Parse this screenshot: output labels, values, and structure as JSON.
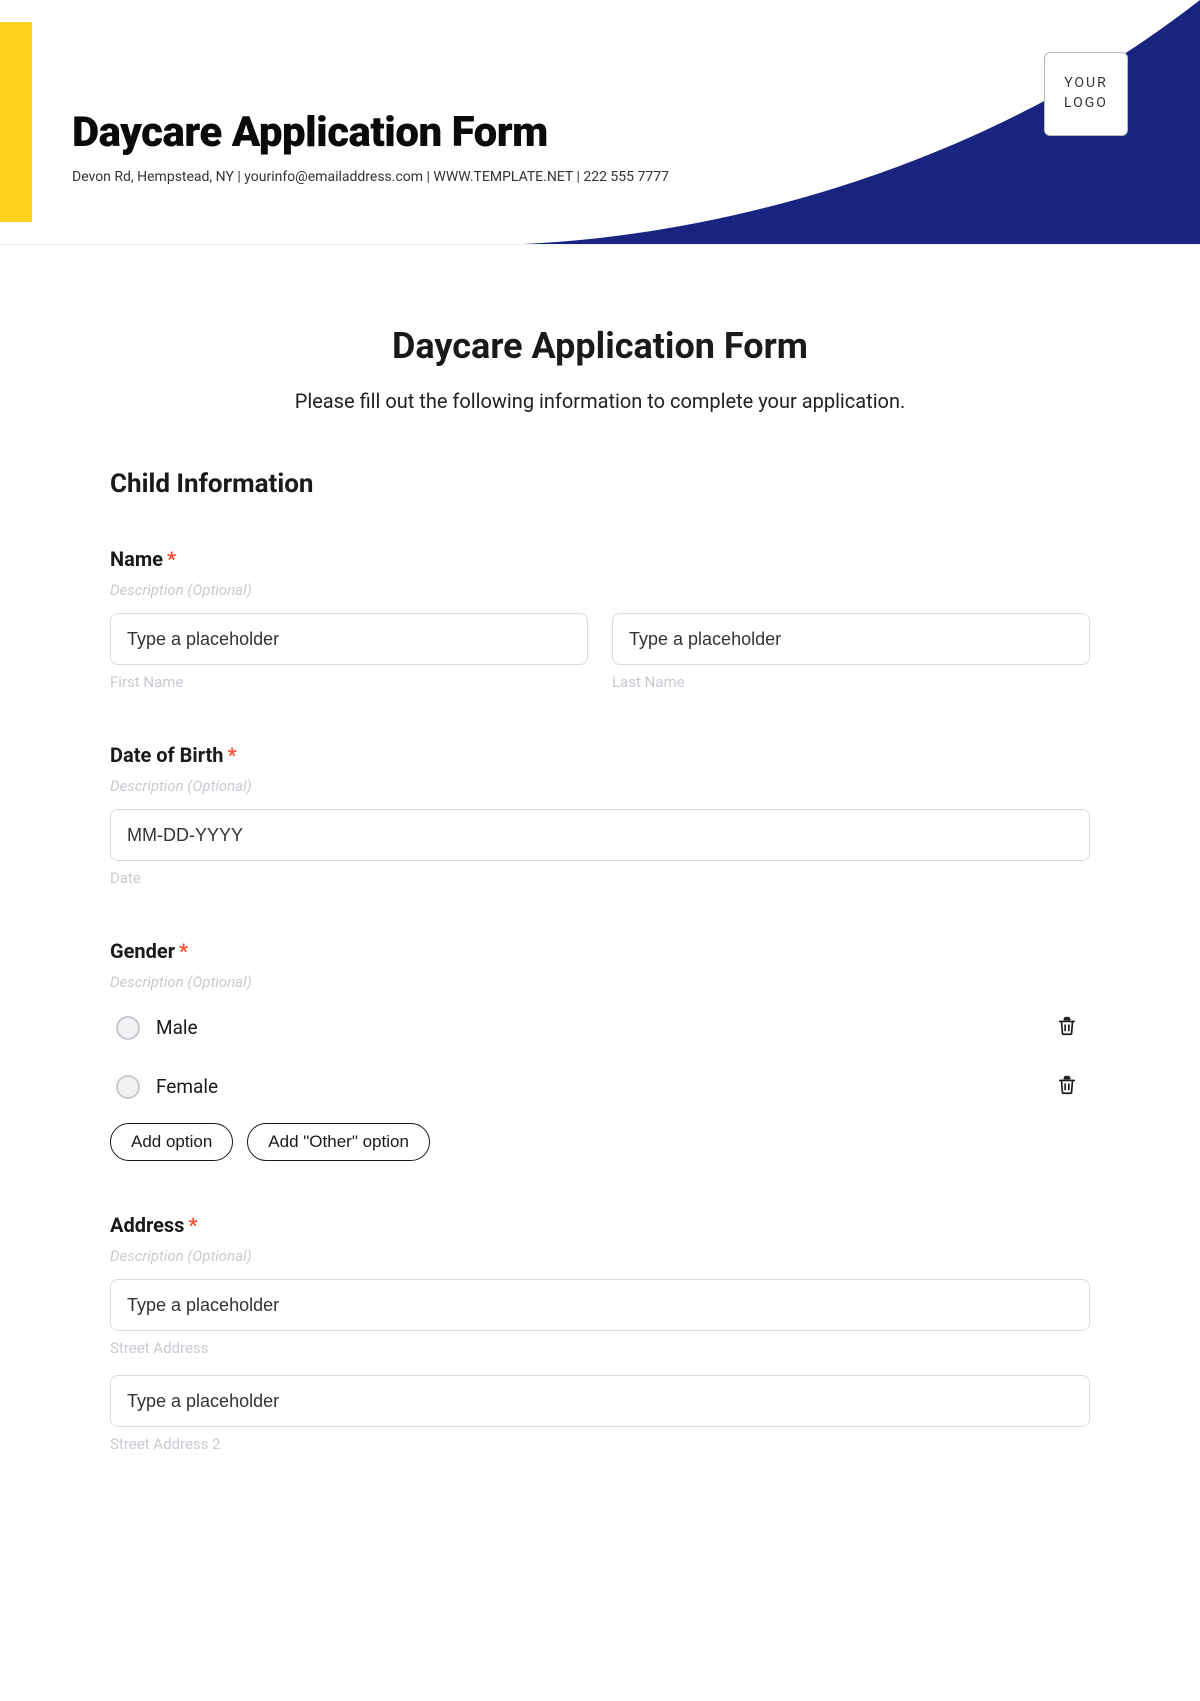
{
  "header": {
    "title": "Daycare Application Form",
    "subtitle": "Devon Rd, Hempstead, NY | yourinfo@emailaddress.com | WWW.TEMPLATE.NET | 222 555 7777",
    "logo_line1": "YOUR",
    "logo_line2": "LOGO"
  },
  "form": {
    "title": "Daycare Application Form",
    "description": "Please fill out the following information to complete your application.",
    "section1_title": "Child Information",
    "desc_placeholder": "Description (Optional)",
    "req_mark": "*",
    "name": {
      "label": "Name",
      "first_ph": "Type a placeholder",
      "last_ph": "Type a placeholder",
      "first_sub": "First Name",
      "last_sub": "Last Name"
    },
    "dob": {
      "label": "Date of Birth",
      "ph": "MM-DD-YYYY",
      "sub": "Date"
    },
    "gender": {
      "label": "Gender",
      "opt1": "Male",
      "opt2": "Female",
      "add_option": "Add option",
      "add_other": "Add \"Other\" option"
    },
    "address": {
      "label": "Address",
      "street_ph": "Type a placeholder",
      "street_sub": "Street Address",
      "street2_ph": "Type a placeholder",
      "street2_sub": "Street Address 2"
    }
  }
}
